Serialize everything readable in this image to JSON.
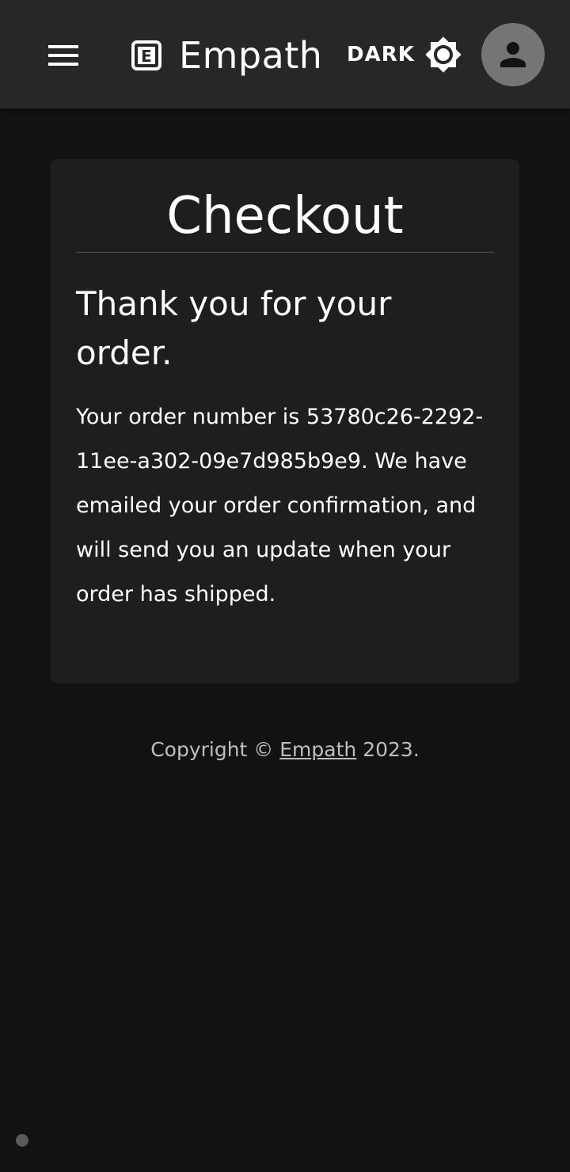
{
  "header": {
    "brand_name": "Empath",
    "brand_logo_letter": "E",
    "theme_label": "DARK",
    "icons": {
      "menu": "menu-icon",
      "logo": "brand-logo-icon",
      "theme": "brightness-icon",
      "avatar": "account-icon"
    }
  },
  "card": {
    "title": "Checkout",
    "heading": "Thank you for your order.",
    "message": "Your order number is 53780c26-2292-11ee-a302-09e7d985b9e9. We have emailed your order confirmation, and will send you an update when your order has shipped."
  },
  "footer": {
    "prefix": "Copyright © ",
    "link_text": "Empath",
    "suffix": " 2023."
  },
  "colors": {
    "background": "#121212",
    "appbar": "#272727",
    "card": "#1e1e1e",
    "avatar": "#757575",
    "text": "#ffffff"
  }
}
